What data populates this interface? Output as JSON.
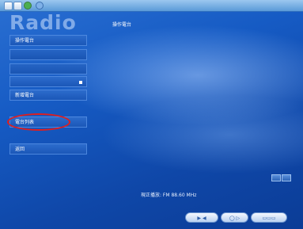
{
  "window": {
    "top_right_text": "",
    "app_title": "Radio"
  },
  "header": {
    "label": "操作電台"
  },
  "sidebar": {
    "items": [
      {
        "label": "操作電台",
        "dim": false
      },
      {
        "label": "",
        "dim": true
      },
      {
        "label": "",
        "dim": true
      },
      {
        "label": "",
        "dim": false
      },
      {
        "label": "新增電台",
        "dim": false
      },
      {
        "label": "電台列表",
        "dim": false
      },
      {
        "label": "返回",
        "dim": false
      }
    ]
  },
  "status": {
    "frequency_text": "現正播放:  FM 88.60 MHz"
  },
  "footer": {
    "buttons": [
      {
        "label": "play",
        "icon": "play-icon"
      },
      {
        "label": "search",
        "icon": "search-icon"
      },
      {
        "label": "save",
        "icon": "save-icon"
      }
    ]
  },
  "annotation": {
    "highlight_color": "#e01e1e"
  },
  "icons": [
    "minimize-icon",
    "status-dot-icon",
    "settings-icon",
    "scroll-up-icon",
    "scroll-down-icon"
  ]
}
